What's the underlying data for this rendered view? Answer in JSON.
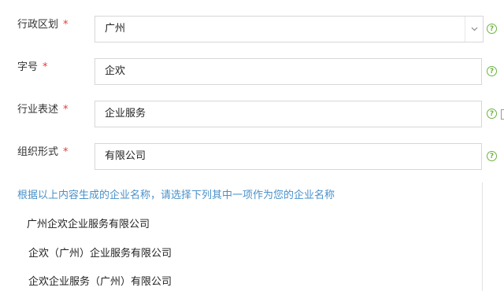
{
  "form": {
    "region": {
      "label": "行政区划",
      "required_mark": "*",
      "value": "广州",
      "help": "?"
    },
    "trade_name": {
      "label": "字号",
      "required_mark": "*",
      "value": "企欢",
      "help": "?"
    },
    "industry": {
      "label": "行业表述",
      "required_mark": "*",
      "value": "企业服务",
      "help": "?"
    },
    "org_form": {
      "label": "组织形式",
      "required_mark": "*",
      "value": "有限公司",
      "help": "?"
    }
  },
  "hint": "根据以上内容生成的企业名称，请选择下列其中一项作为您的企业名称",
  "options": [
    "广州企欢企业服务有限公司",
    "企欢（广州）企业服务有限公司",
    "企欢企业服务（广州）有限公司"
  ],
  "icons": {
    "dropdown": "chevron-down-icon",
    "help": "question-circle-icon"
  },
  "colors": {
    "required": "#e23a3a",
    "help_icon": "#6bb33f",
    "hint_text": "#4a90c9",
    "border": "#d7d7d7"
  }
}
